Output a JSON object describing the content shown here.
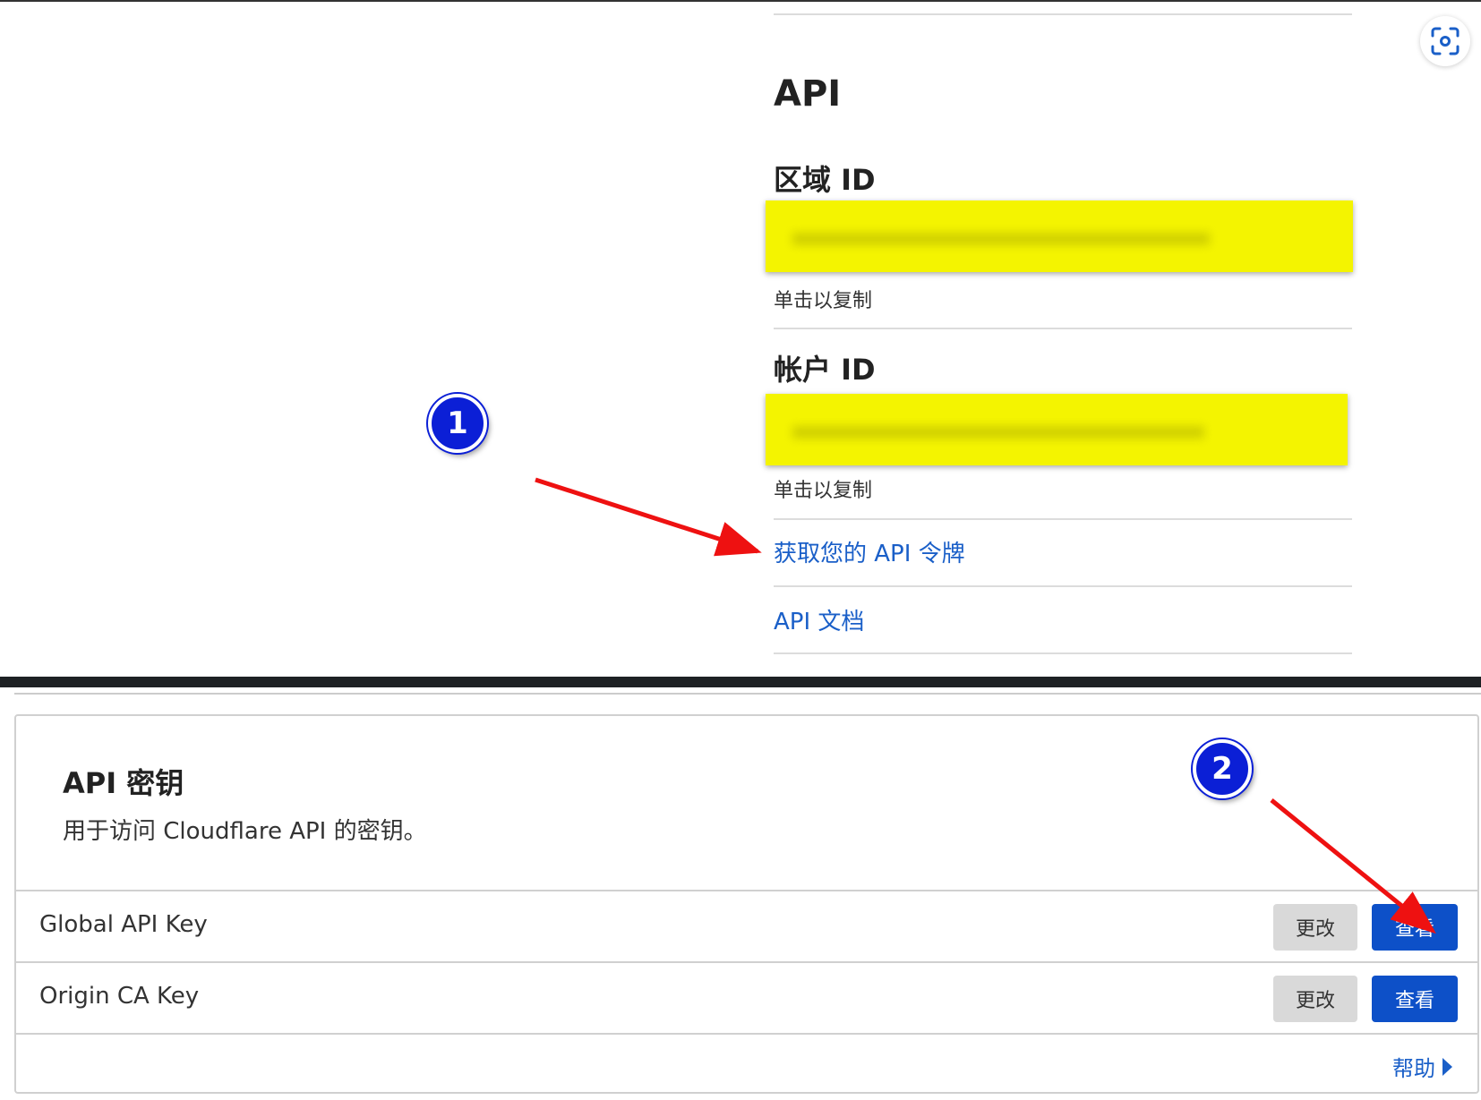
{
  "api_section": {
    "heading": "API",
    "zone_id_label": "区域 ID",
    "zone_id_hint": "单击以复制",
    "account_id_label": "帐户 ID",
    "account_id_hint": "单击以复制",
    "get_token_link": "获取您的 API 令牌",
    "docs_link": "API 文档"
  },
  "annotations": {
    "badge_1": "1",
    "badge_2": "2",
    "highlight_color": "#f4f400",
    "arrow_color": "#ee1111",
    "badge_color": "#0b1fd6"
  },
  "keys_card": {
    "title": "API 密钥",
    "description": "用于访问 Cloudflare API 的密钥。",
    "rows": [
      {
        "label": "Global API Key",
        "change_label": "更改",
        "view_label": "查看"
      },
      {
        "label": "Origin CA Key",
        "change_label": "更改",
        "view_label": "查看"
      }
    ],
    "help_label": "帮助"
  },
  "icons": {
    "screenshot_lens": "focus-scan-icon",
    "help_arrow": "caret-right-icon"
  },
  "colors": {
    "link": "#1a5fc8",
    "primary_button": "#0d50c8",
    "secondary_button": "#d9d9d9"
  }
}
